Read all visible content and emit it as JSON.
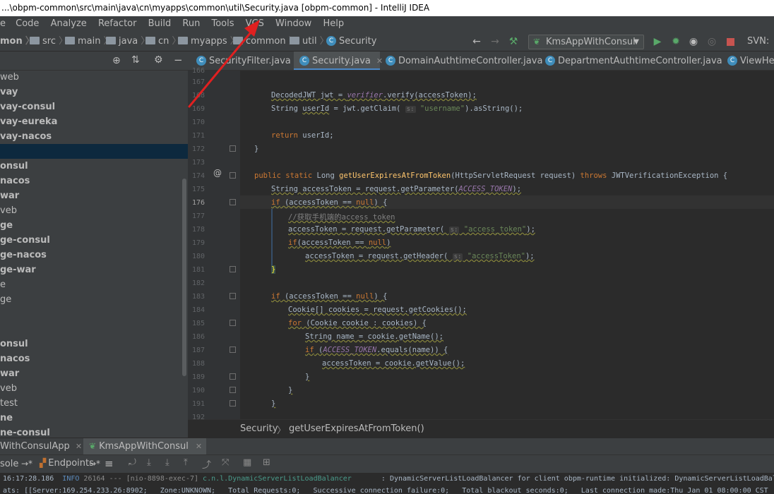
{
  "window": {
    "title": "...\\obpm-common\\src\\main\\java\\cn\\myapps\\common\\util\\Security.java [obpm-common] - IntelliJ IDEA"
  },
  "menu": [
    {
      "label": "Code"
    },
    {
      "label": "Analyze"
    },
    {
      "label": "Refactor"
    },
    {
      "label": "Build"
    },
    {
      "label": "Run"
    },
    {
      "label": "Tools"
    },
    {
      "label": "VCS"
    },
    {
      "label": "Window"
    },
    {
      "label": "Help"
    }
  ],
  "breadcrumbs": [
    "mon",
    "src",
    "main",
    "java",
    "cn",
    "myapps",
    "common",
    "util",
    "Security"
  ],
  "toolbar": {
    "run_config": "KmsAppWithConsul",
    "svn_label": "SVN:"
  },
  "sidebar": {
    "items": [
      {
        "label": "web",
        "bold": false
      },
      {
        "label": "vay",
        "bold": true
      },
      {
        "label": "vay-consul",
        "bold": true
      },
      {
        "label": "vay-eureka",
        "bold": true
      },
      {
        "label": "vay-nacos",
        "bold": true
      },
      {
        "label": "",
        "bold": true
      },
      {
        "label": "onsul",
        "bold": true
      },
      {
        "label": "nacos",
        "bold": true
      },
      {
        "label": "war",
        "bold": true
      },
      {
        "label": "veb",
        "bold": false
      },
      {
        "label": "ge",
        "bold": true
      },
      {
        "label": "ge-consul",
        "bold": true
      },
      {
        "label": "ge-nacos",
        "bold": true
      },
      {
        "label": "ge-war",
        "bold": true
      },
      {
        "label": "e",
        "bold": false
      },
      {
        "label": "ge",
        "bold": false
      },
      {
        "label": "",
        "bold": false
      },
      {
        "label": "",
        "bold": false
      },
      {
        "label": "onsul",
        "bold": true
      },
      {
        "label": "nacos",
        "bold": true
      },
      {
        "label": "war",
        "bold": true
      },
      {
        "label": "veb",
        "bold": false
      },
      {
        "label": "test",
        "bold": false
      },
      {
        "label": "ne",
        "bold": true
      },
      {
        "label": "ne-consul",
        "bold": true
      }
    ]
  },
  "tabs": [
    {
      "label": "SecurityFilter.java"
    },
    {
      "label": "Security.java"
    },
    {
      "label": "DomainAuthtimeController.java"
    },
    {
      "label": "DepartmentAuthtimeController.java"
    },
    {
      "label": "ViewHelp"
    }
  ],
  "gutter": {
    "lines": [
      "166",
      "167",
      "168",
      "169",
      "170",
      "171",
      "172",
      "173",
      "174",
      "175",
      "176",
      "177",
      "178",
      "179",
      "180",
      "181",
      "182",
      "183",
      "184",
      "185",
      "186",
      "187",
      "188",
      "189",
      "190",
      "191",
      "192"
    ],
    "current": "176"
  },
  "code": {
    "l168a": "DecodedJWT jwt = ",
    "l168b": "verifier",
    "l168c": ".verify(accessToken);",
    "l169a": "String ",
    "l169b": "userId",
    "l169c": " = jwt.getClaim( ",
    "l169p": "s:",
    "l169s": " \"username\"",
    "l169d": ").asString();",
    "l171a": "return",
    "l171b": " userId;",
    "l172": "}",
    "l174a": "public static",
    "l174b": " Long ",
    "l174c": "getUserExpiresAtFromToken",
    "l174d": "(HttpServletRequest request) ",
    "l174e": "throws",
    "l174f": " JWTVerificationException {",
    "l175a": "String accessToken = request.getParameter(",
    "l175b": "ACCESS_TOKEN",
    "l175c": ");",
    "l176a": "if",
    "l176b": " (accessToken == ",
    "l176c": "null",
    "l176d": ") {",
    "l177": "//获取手机端的access_token",
    "l178a": "accessToken = request.getParameter( ",
    "l178p": "s:",
    "l178s": " \"access_token\"",
    "l178c": ");",
    "l179a": "if",
    "l179b": "(accessToken == ",
    "l179c": "null",
    "l179d": ")",
    "l180a": "accessToken = request.getHeader( ",
    "l180p": "s:",
    "l180s": " \"accessToken\"",
    "l180c": ");",
    "l181": "}",
    "l183a": "if",
    "l183b": " (accessToken == ",
    "l183c": "null",
    "l183d": ") {",
    "l184": "Cookie[] cookies = request.getCookies();",
    "l185a": "for",
    "l185b": " (Cookie cookie : cookies) {",
    "l186": "String name = cookie.getName();",
    "l187a": "if",
    "l187b": " (",
    "l187c": "ACCESS_TOKEN",
    "l187d": ".equals(name)) {",
    "l188": "accessToken = cookie.getValue();",
    "l189": "}",
    "l190": "}",
    "l191": "}"
  },
  "editor_breadcrumb": {
    "class_name": "Security",
    "method_name": "getUserExpiresAtFromToken()"
  },
  "run": {
    "tabs": [
      "WithConsulApp",
      "KmsAppWithConsul"
    ],
    "console_label": "sole",
    "endpoints_label": "Endpoints"
  },
  "console": {
    "line1_time": "16:17:28.186",
    "line1_level": "INFO",
    "line1_pid": "26164",
    "line1_sep": "---",
    "line1_thread": "[nio-8898-exec-7]",
    "line1_class": "c.n.l.DynamicServerListLoadBalancer",
    "line1_msg": ": DynamicServerListLoadBalancer for client obpm-runtime initialized: DynamicServerListLoadBala",
    "line2": "ats: [[Server:169.254.233.26:8902;   Zone:UNKNOWN;   Total Requests:0;   Successive connection failure:0;   Total blackout seconds:0;   Last connection made:Thu Jan 01 08:00:00 CST"
  },
  "colors": {
    "accent": "#4a88c7",
    "keyword": "#cc7832",
    "string": "#6a8759",
    "function": "#ffc66d",
    "constant": "#9876aa",
    "arrow": "#e02020"
  }
}
